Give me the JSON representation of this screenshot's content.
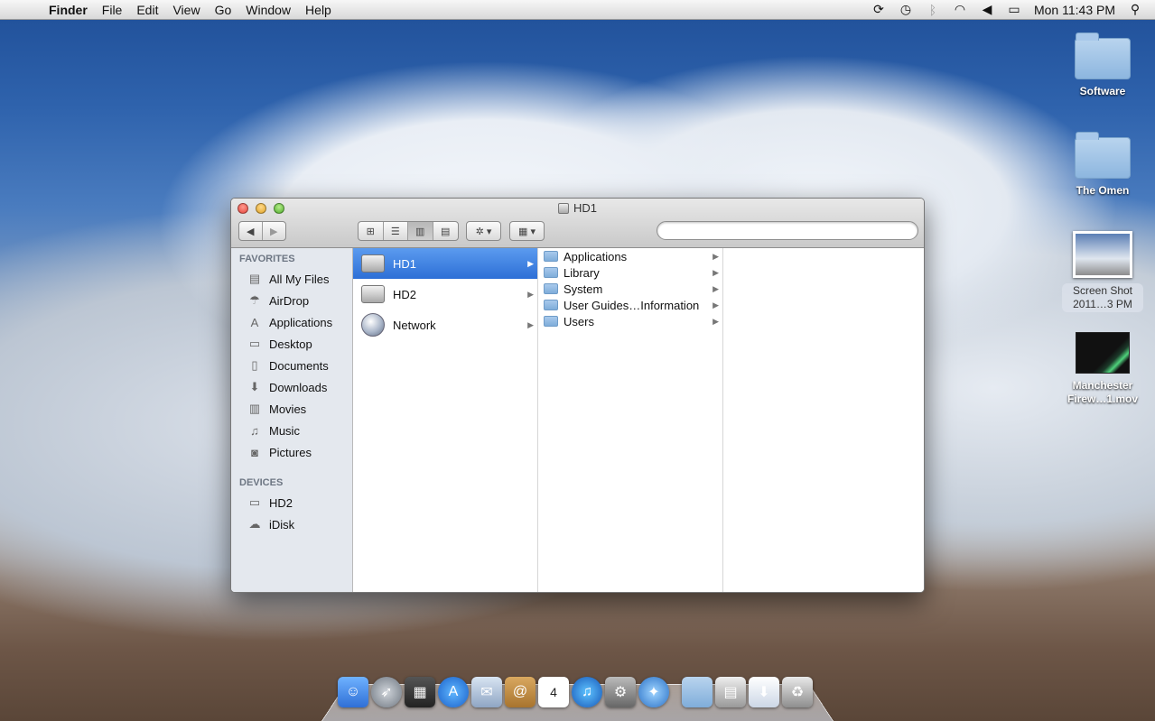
{
  "menubar": {
    "app_name": "Finder",
    "menus": [
      "File",
      "Edit",
      "View",
      "Go",
      "Window",
      "Help"
    ],
    "clock": "Mon 11:43 PM"
  },
  "desktop": {
    "icons": [
      {
        "label": "Software"
      },
      {
        "label": "The Omen"
      },
      {
        "label": "Screen Shot 2011…3 PM"
      },
      {
        "label": "Manchester Firew…1.mov"
      }
    ]
  },
  "window": {
    "title": "HD1",
    "search_placeholder": ""
  },
  "sidebar": {
    "favorites_heading": "FAVORITES",
    "favorites": [
      {
        "label": "All My Files",
        "icon": "all-files-icon"
      },
      {
        "label": "AirDrop",
        "icon": "airdrop-icon"
      },
      {
        "label": "Applications",
        "icon": "applications-icon"
      },
      {
        "label": "Desktop",
        "icon": "desktop-icon"
      },
      {
        "label": "Documents",
        "icon": "documents-icon"
      },
      {
        "label": "Downloads",
        "icon": "downloads-icon"
      },
      {
        "label": "Movies",
        "icon": "movies-icon"
      },
      {
        "label": "Music",
        "icon": "music-icon"
      },
      {
        "label": "Pictures",
        "icon": "pictures-icon"
      }
    ],
    "devices_heading": "DEVICES",
    "devices": [
      {
        "label": "HD2",
        "icon": "hard-disk-icon"
      },
      {
        "label": "iDisk",
        "icon": "idisk-icon"
      }
    ]
  },
  "columns": {
    "col1": [
      {
        "label": "HD1",
        "selected": true
      },
      {
        "label": "HD2",
        "selected": false
      },
      {
        "label": "Network",
        "selected": false
      }
    ],
    "col2": [
      {
        "label": "Applications"
      },
      {
        "label": "Library"
      },
      {
        "label": "System"
      },
      {
        "label": "User Guides…Information"
      },
      {
        "label": "Users"
      }
    ]
  },
  "dock": {
    "calendar_day": "4"
  }
}
